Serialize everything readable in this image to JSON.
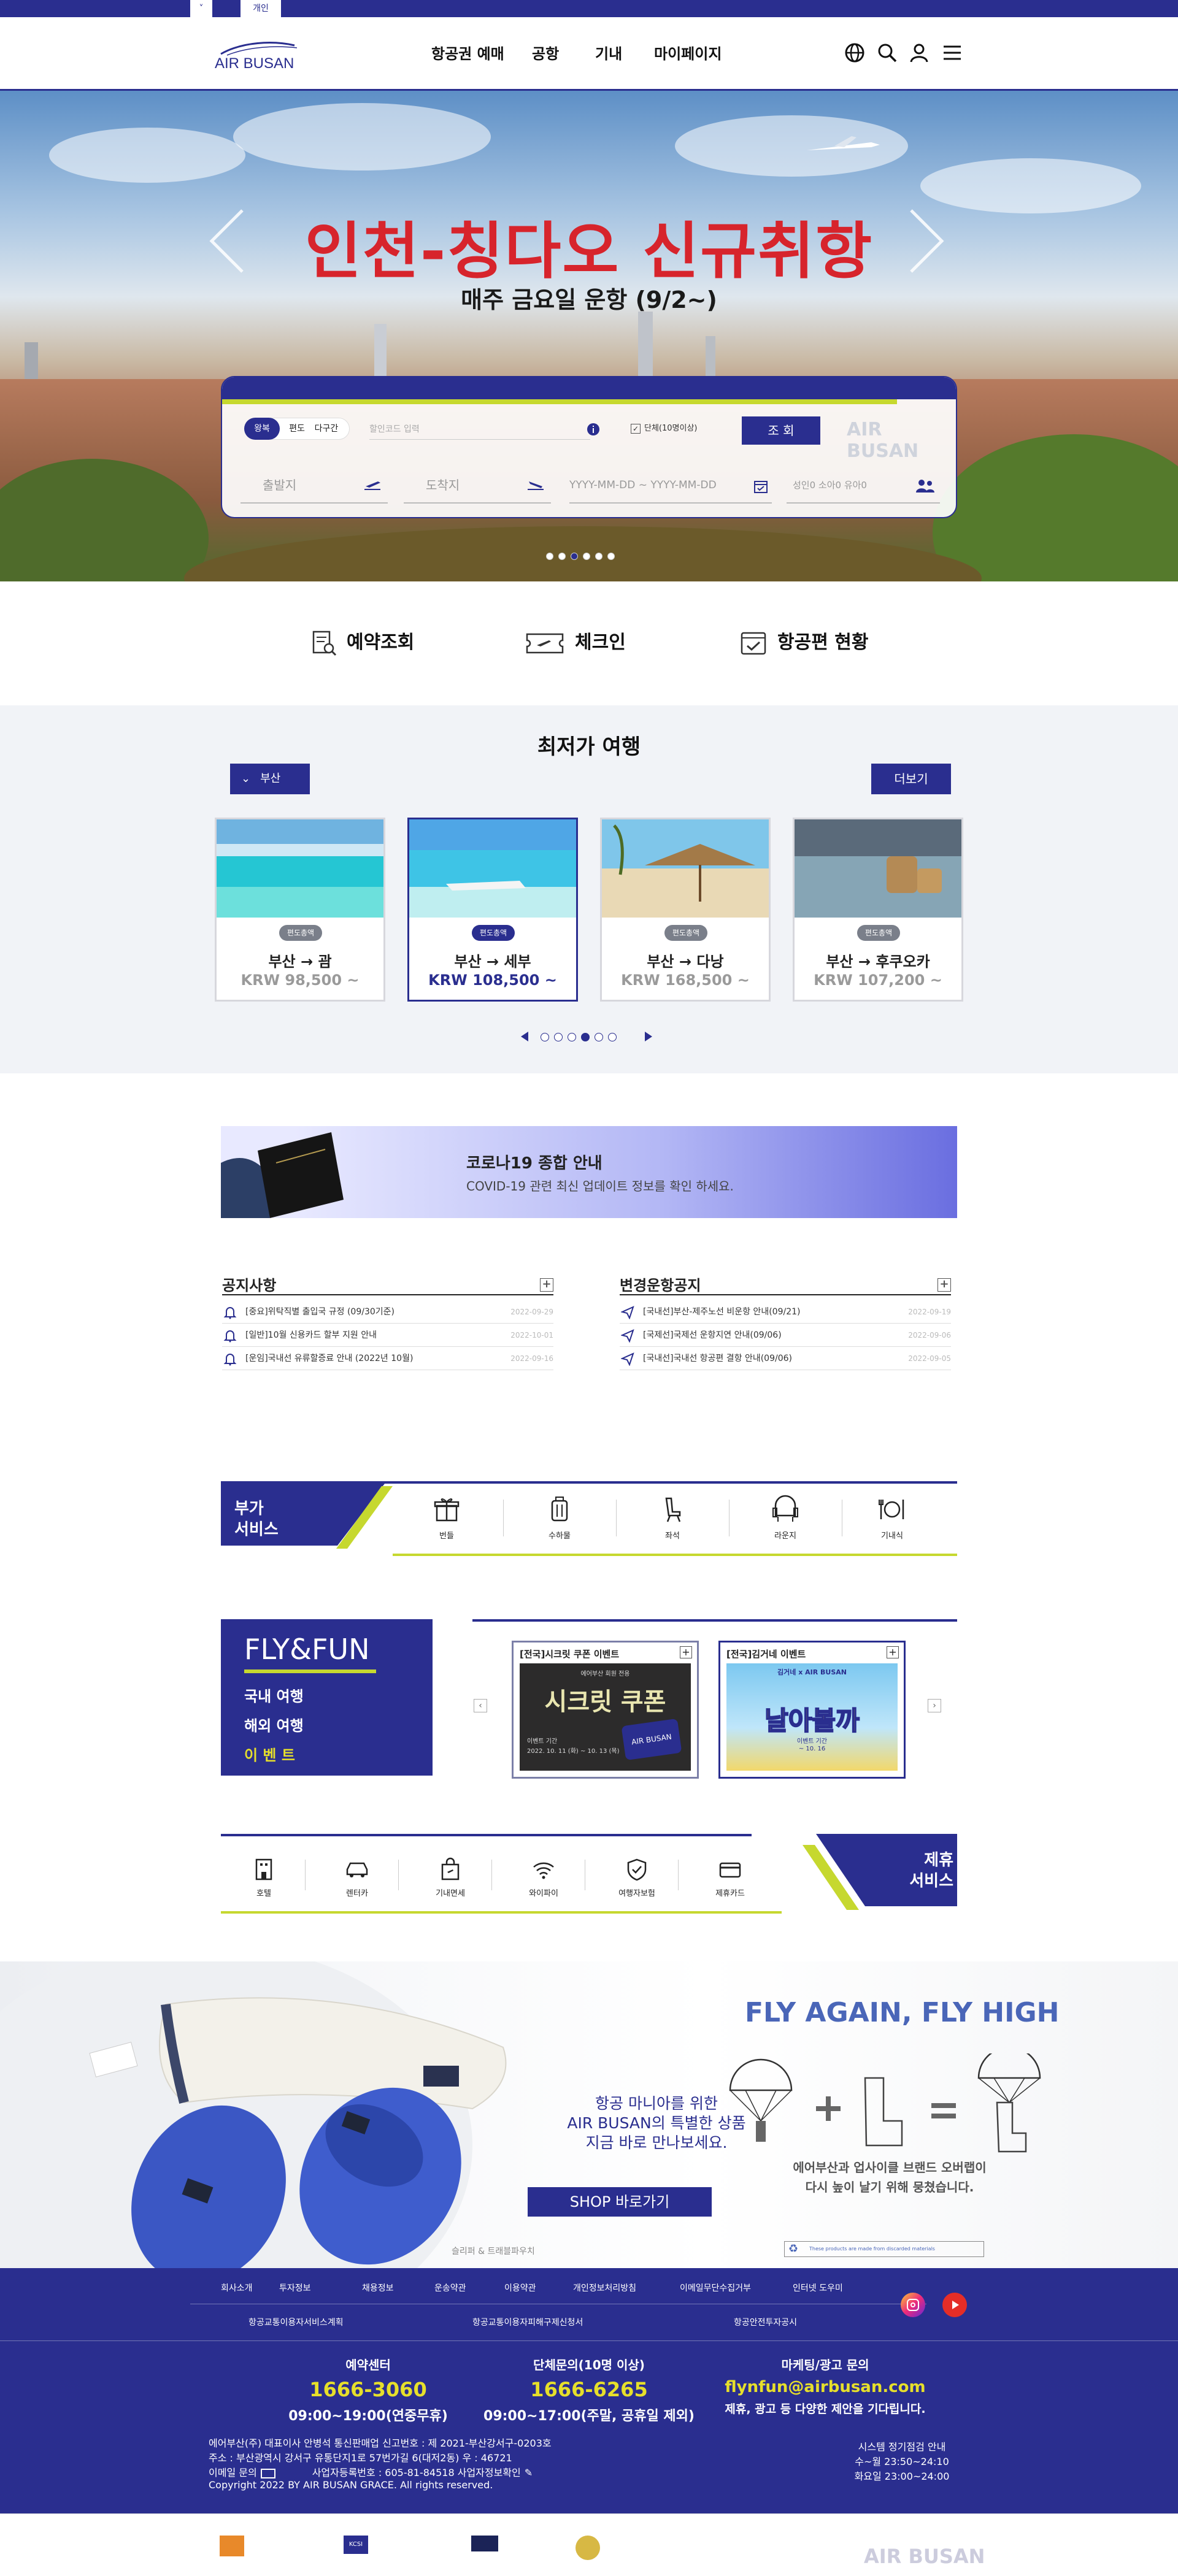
{
  "topstrip": {
    "tab_left": "˅",
    "tab_active": "개인"
  },
  "header": {
    "logo": "AIR BUSAN",
    "nav": [
      "항공권 예매",
      "공항",
      "기내",
      "마이페이지"
    ]
  },
  "hero": {
    "title": "인천-칭다오 신규취항",
    "subtitle": "매주 금요일 운항 (9/2~)",
    "trip_types": [
      "왕복",
      "편도",
      "다구간"
    ],
    "promo_placeholder": "할인코드 입력",
    "group_label": "단체(10명이상)",
    "search_button": "조 회",
    "depart_placeholder": "출발지",
    "arrive_placeholder": "도착지",
    "date_placeholder": "YYYY-MM-DD ~ YYYY-MM-DD",
    "pax_label": "성인0 소아0 유아0",
    "watermark": "AIR BUSAN",
    "slides": 6,
    "active_slide": 3
  },
  "quick": [
    "예약조회",
    "체크인",
    "항공편 현황"
  ],
  "fare": {
    "title": "최저가 여행",
    "city": "부산",
    "more": "더보기",
    "cards": [
      {
        "tag": "편도총액",
        "from": "부산",
        "to": "괌",
        "price": "KRW 98,500 ~"
      },
      {
        "tag": "편도총액",
        "from": "부산",
        "to": "세부",
        "price": "KRW 108,500 ~"
      },
      {
        "tag": "편도총액",
        "from": "부산",
        "to": "다낭",
        "price": "KRW 168,500 ~"
      },
      {
        "tag": "편도총액",
        "from": "부산",
        "to": "후쿠오카",
        "price": "KRW 107,200 ~"
      }
    ],
    "pages": 6,
    "active_page": 4
  },
  "covid": {
    "title": "코로나19 종합 안내",
    "desc": "COVID-19 관련 최신 업데이트 정보를 확인 하세요."
  },
  "notices": {
    "title": "공지사항",
    "items": [
      {
        "text": "[중요]위탁직별 출입국 규정 (09/30기준)",
        "date": "2022-09-29"
      },
      {
        "text": "[일반]10월 신용카드 할부 지원 안내",
        "date": "2022-10-01"
      },
      {
        "text": "[운임]국내선 유류할증료 안내 (2022년 10월)",
        "date": "2022-09-16"
      }
    ]
  },
  "schedule": {
    "title": "변경운항공지",
    "items": [
      {
        "text": "[국내선]부산-제주노선 비운항 안내(09/21)",
        "date": "2022-09-19"
      },
      {
        "text": "[국제선]국제선 운항지연 안내(09/06)",
        "date": "2022-09-06"
      },
      {
        "text": "[국내선]국내선 항공편 결항 안내(09/06)",
        "date": "2022-09-05"
      }
    ]
  },
  "extra": {
    "title_line1": "부가",
    "title_line2": "서비스",
    "items": [
      "번들",
      "수하물",
      "좌석",
      "라운지",
      "기내식"
    ]
  },
  "flyfun": {
    "title": "FLY&FUN",
    "menu": [
      "국내 여행",
      "해외 여행",
      "이 벤 트"
    ],
    "events": [
      {
        "title": "[전국]시크릿 쿠폰 이벤트",
        "big": "시크릿 쿠폰",
        "small": "에어부산 회원 전용",
        "period": "이벤트 기간",
        "dates": "2022. 10. 11 (화) ~ 10. 13 (목)"
      },
      {
        "title": "[전국]김거네 이벤트",
        "big": "날아볼까",
        "small": "김거네 x AIR BUSAN",
        "period": "이벤트 기간",
        "dates": "~ 10. 16"
      }
    ]
  },
  "partner": {
    "title_line1": "제휴",
    "title_line2": "서비스",
    "items": [
      "호텔",
      "렌터카",
      "기내면세",
      "와이파이",
      "여행자보험",
      "제휴카드"
    ]
  },
  "banner": {
    "line1": "항공 마니아를 위한",
    "line2": "AIR BUSAN의 특별한 상품",
    "line3": "지금 바로 만나보세요.",
    "shop": "SHOP 바로가기",
    "caption": "슬리퍼 & 트래블파우치",
    "headline": "FLY AGAIN, FLY HIGH",
    "desc1": "에어부산과 업사이클 브랜드 오버랩이",
    "desc2": "다시 높이 날기 위해 뭉쳤습니다.",
    "notice": "These products are made from discarded materials"
  },
  "footer": {
    "links1": [
      "회사소개",
      "투자정보",
      "채용정보",
      "운송약관",
      "이용약관",
      "개인정보처리방침",
      "이메일무단수집거부",
      "인터넷 도우미"
    ],
    "links2": [
      "항공교통이용자서비스계획",
      "항공교통이용자피해구제신청서",
      "항공안전투자공시"
    ],
    "contacts": [
      {
        "a": "예약센터",
        "b": "1666-3060",
        "c": "09:00~19:00(연중무휴)"
      },
      {
        "a": "단체문의(10명 이상)",
        "b": "1666-6265",
        "c": "09:00~17:00(주말, 공휴일 제외)"
      },
      {
        "a": "마케팅/광고 문의",
        "b": "flynfun@airbusan.com",
        "c": "제휴, 광고 등 다양한 제안을 기다립니다."
      }
    ],
    "info1": "에어부산(주) 대표이사 안병석    통신판매업 신고번호 : 제 2021-부산강서구-0203호",
    "info2": "주소 : 부산광역시 강서구 유통단지1로 57번가길 6(대저2동)     우 : 46721",
    "info3": "이메일 문의",
    "info4": "사업자등록번호 : 605-81-84518 사업자정보확인",
    "copyright": "Copyright 2022 BY AIR BUSAN GRACE. All rights reserved.",
    "maint_title": "시스템 정기점검 안내",
    "maint1": "수~월  23:50~24:10",
    "maint2": "화요일 23:00~24:00"
  },
  "bottom_logo": "AIR BUSAN",
  "colors": {
    "navy": "#2a2e8f",
    "lime": "#c6d82f",
    "red": "#d7242c",
    "yellow": "#e6df2b"
  }
}
